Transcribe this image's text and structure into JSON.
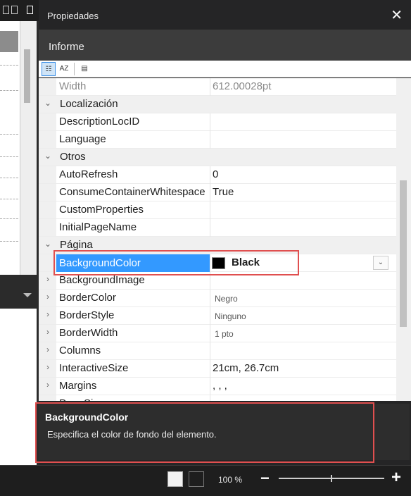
{
  "panel": {
    "title": "Propiedades",
    "object_name": "Informe"
  },
  "toolbar": {
    "categorized_icon": "categorized-icon",
    "alphabetical_icon": "sort-az-icon",
    "property_pages_icon": "property-pages-icon",
    "alphabetical_label": "AZ"
  },
  "rows": [
    {
      "name": "Width",
      "value": "612.00028pt",
      "type": "prop",
      "greyed": true
    },
    {
      "name": "Localización",
      "type": "category"
    },
    {
      "name": "DescriptionLocID",
      "value": "",
      "type": "prop"
    },
    {
      "name": "Language",
      "value": "",
      "type": "prop"
    },
    {
      "name": "Otros",
      "type": "category"
    },
    {
      "name": "AutoRefresh",
      "value": "0",
      "type": "prop"
    },
    {
      "name": "ConsumeContainerWhitespace",
      "value": "True",
      "type": "prop"
    },
    {
      "name": "CustomProperties",
      "value": "",
      "type": "prop"
    },
    {
      "name": "InitialPageName",
      "value": "",
      "type": "prop"
    },
    {
      "name": "Página",
      "type": "category"
    },
    {
      "name": "BackgroundColor",
      "value": "Black",
      "type": "prop",
      "selected": true
    },
    {
      "name": "BackgroundImage",
      "value": "",
      "type": "expandable"
    },
    {
      "name": "BorderColor",
      "value": "Negro",
      "type": "expandable",
      "small": true
    },
    {
      "name": "BorderStyle",
      "value": "Ninguno",
      "type": "expandable",
      "small": true
    },
    {
      "name": "BorderWidth",
      "value": "1 pto",
      "type": "expandable",
      "small": true
    },
    {
      "name": "Columns",
      "value": "",
      "type": "expandable"
    },
    {
      "name": "InteractiveSize",
      "value": "21cm, 26.7cm",
      "type": "expandable"
    },
    {
      "name": "Margins",
      "value": ", , ,",
      "type": "expandable"
    },
    {
      "name": "PageSize",
      "value": "",
      "type": "expandable"
    }
  ],
  "description": {
    "title": "BackgroundColor",
    "text": "Especifica el color de fondo del elemento."
  },
  "statusbar": {
    "zoom": "100 %"
  },
  "colors": {
    "selection": "#3399ff",
    "highlight_box": "#e04f4f",
    "panel_bg": "#252526"
  }
}
